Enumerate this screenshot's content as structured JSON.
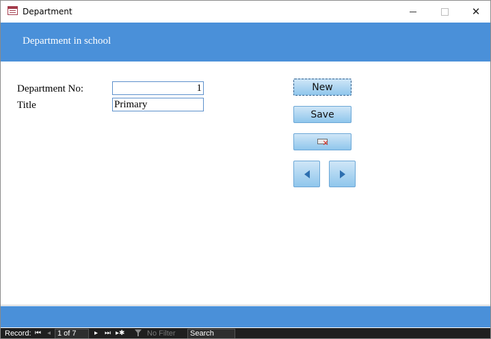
{
  "window": {
    "title": "Department"
  },
  "header": {
    "title": "Department in school"
  },
  "form": {
    "dept_no_label": "Department No:",
    "dept_no_value": "1",
    "title_label": "Title",
    "title_value": "Primary"
  },
  "buttons": {
    "new_label": "New",
    "save_label": "Save",
    "delete_icon": "delete-record-icon",
    "prev_icon": "triangle-left-icon",
    "next_icon": "triangle-right-icon"
  },
  "navigation": {
    "record_label": "Record:",
    "position": "1 of 7",
    "filter_label": "No Filter",
    "search_placeholder": "Search"
  },
  "colors": {
    "header_blue": "#4a90d9",
    "button_blue": "#8fc6ec",
    "nav_dark": "#1f1f1f"
  }
}
